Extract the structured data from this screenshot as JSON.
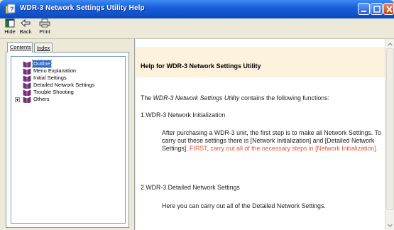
{
  "window": {
    "title": "WDR-3 Network Settings Utility Help"
  },
  "toolbar": {
    "hide_label": "Hide",
    "back_label": "Back",
    "print_label": "Print"
  },
  "nav": {
    "tab_contents": "Contents",
    "tab_index": "Index",
    "active_tab": "Contents",
    "items": [
      {
        "label": "Outline",
        "selected": true
      },
      {
        "label": "Menu Explanation",
        "selected": false
      },
      {
        "label": "Initial Settings",
        "selected": false
      },
      {
        "label": "Detailed Network Settings",
        "selected": false
      },
      {
        "label": "Trouble Shooting",
        "selected": false
      },
      {
        "label": "Others",
        "selected": false,
        "expandable": true
      }
    ]
  },
  "content": {
    "banner_title": "Help for WDR-3 Network Settings Utility",
    "intro_prefix": "The ",
    "intro_em": "WDR-3 Network Settings Utility",
    "intro_suffix": " contains the following functions:",
    "section1_heading": "1.WDR-3 Network Initialization",
    "section1_body": "After purchasing a WDR-3 unit, the first step is to make all Network Settings. To carry out these settings there is [Network Initialization] and [Detailed Network Settings]. ",
    "section1_warning": "FIRST, carry out all of the necessary steps in [Network Initialization].",
    "section2_heading": "2.WDR-3 Detailed Network Settings",
    "section2_body": "Here you can carry out all of the Detailed Network Settings."
  },
  "colors": {
    "titlebar": "#0f4fc8",
    "banner_bg": "#fdf2dc",
    "warning_text": "#e0563a",
    "selection": "#316ac5"
  }
}
